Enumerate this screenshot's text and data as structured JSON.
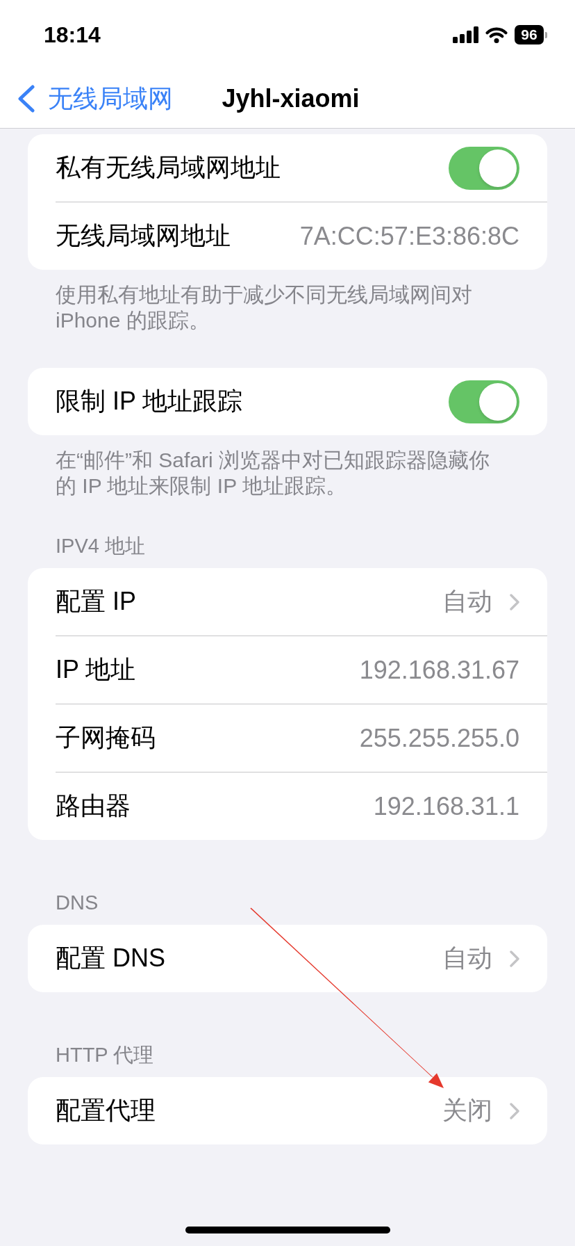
{
  "status_bar": {
    "time": "18:14",
    "battery": "96"
  },
  "nav": {
    "back": "无线局域网",
    "title": "Jyhl-xiaomi"
  },
  "sections": [
    {
      "rows": [
        {
          "kind": "toggle",
          "label": "私有无线局域网地址",
          "on": true
        },
        {
          "kind": "value",
          "label": "无线局域网地址",
          "value": "7A:CC:57:E3:86:8C"
        }
      ],
      "footer": "使用私有地址有助于减少不同无线局域网间对 iPhone 的跟踪。"
    },
    {
      "rows": [
        {
          "kind": "toggle",
          "label": "限制 IP 地址跟踪",
          "on": true
        }
      ],
      "footer": "在“邮件”和 Safari 浏览器中对已知跟踪器隐藏你的 IP 地址来限制 IP 地址跟踪。"
    },
    {
      "header": "IPV4 地址",
      "rows": [
        {
          "kind": "link",
          "label": "配置 IP",
          "value": "自动"
        },
        {
          "kind": "value",
          "label": "IP 地址",
          "value": "192.168.31.67"
        },
        {
          "kind": "value",
          "label": "子网掩码",
          "value": "255.255.255.0"
        },
        {
          "kind": "value",
          "label": "路由器",
          "value": "192.168.31.1"
        }
      ]
    },
    {
      "header": "DNS",
      "rows": [
        {
          "kind": "link",
          "label": "配置 DNS",
          "value": "自动"
        }
      ]
    },
    {
      "header": "HTTP 代理",
      "rows": [
        {
          "kind": "link",
          "label": "配置代理",
          "value": "关闭"
        }
      ]
    }
  ]
}
